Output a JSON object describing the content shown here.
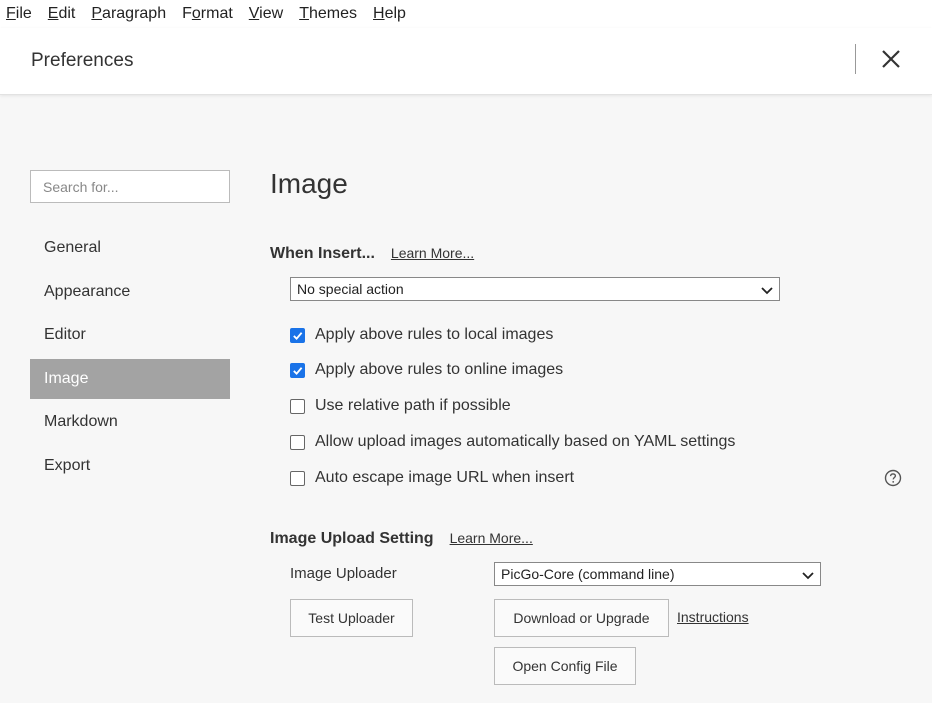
{
  "menubar": {
    "items": [
      {
        "u": "F",
        "rest": "ile"
      },
      {
        "u": "E",
        "rest": "dit"
      },
      {
        "u": "P",
        "rest": "aragraph"
      },
      {
        "pre": "F",
        "u": "o",
        "rest": "rmat"
      },
      {
        "u": "V",
        "rest": "iew"
      },
      {
        "u": "T",
        "rest": "hemes"
      },
      {
        "u": "H",
        "rest": "elp"
      }
    ]
  },
  "header": {
    "title": "Preferences",
    "close_icon": "close-icon"
  },
  "sidebar": {
    "search_placeholder": "Search for...",
    "items": [
      {
        "label": "General"
      },
      {
        "label": "Appearance"
      },
      {
        "label": "Editor"
      },
      {
        "label": "Image",
        "active": true
      },
      {
        "label": "Markdown"
      },
      {
        "label": "Export"
      }
    ]
  },
  "main": {
    "title": "Image",
    "when_insert": {
      "heading": "When Insert...",
      "learn_more": "Learn More...",
      "action_selected": "No special action",
      "options": [
        {
          "label": "Apply above rules to local images",
          "checked": true
        },
        {
          "label": "Apply above rules to online images",
          "checked": true
        },
        {
          "label": "Use relative path if possible",
          "checked": false
        },
        {
          "label": "Allow upload images automatically based on YAML settings",
          "checked": false
        },
        {
          "label": "Auto escape image URL when insert",
          "checked": false
        }
      ],
      "help_icon": "question-circle-icon"
    },
    "upload": {
      "heading": "Image Upload Setting",
      "learn_more": "Learn More...",
      "uploader_label": "Image Uploader",
      "uploader_selected": "PicGo-Core (command line)",
      "test_button": "Test Uploader",
      "download_button": "Download or Upgrade",
      "instructions_link": "Instructions",
      "open_config_button": "Open Config File"
    }
  },
  "colors": {
    "active_nav": "#a3a3a3",
    "checkbox": "#1a73e8",
    "background": "#f7f7f7"
  }
}
